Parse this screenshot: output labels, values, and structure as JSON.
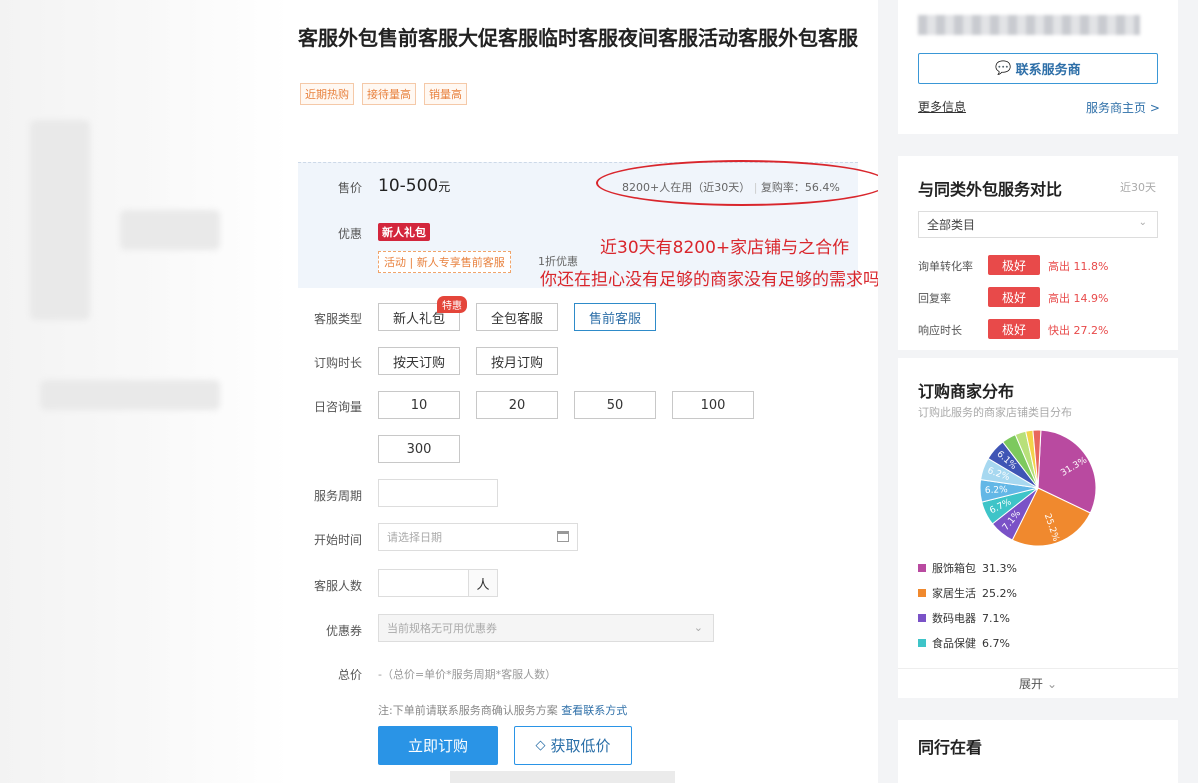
{
  "title": "客服外包售前客服大促客服临时客服夜间客服活动客服外包客服",
  "tags": [
    "近期热购",
    "接待量高",
    "销量高"
  ],
  "price": {
    "label": "售价",
    "value": "10-500",
    "unit": "元",
    "users": "8200+人在用（近30天）",
    "repurchase": "复购率：56.4%"
  },
  "promo": {
    "label": "优惠",
    "gift_badge": "新人礼包",
    "tag": "活动 | 新人专享售前客服",
    "discount": "1折优惠"
  },
  "annotation": {
    "line1": "近30天有8200+家店铺与之合作",
    "line2": "你还在担心没有足够的商家没有足够的需求吗？"
  },
  "form": {
    "service_type": {
      "label": "客服类型",
      "options": [
        "新人礼包",
        "全包客服",
        "售前客服"
      ],
      "hot_badge": "特惠",
      "selected": "售前客服"
    },
    "duration": {
      "label": "订购时长",
      "options": [
        "按天订购",
        "按月订购"
      ]
    },
    "volume": {
      "label": "日咨询量",
      "options": [
        "10",
        "20",
        "50",
        "100",
        "300"
      ]
    },
    "period": {
      "label": "服务周期",
      "value": ""
    },
    "start_date": {
      "label": "开始时间",
      "placeholder": "请选择日期"
    },
    "staff_count": {
      "label": "客服人数",
      "value": "",
      "unit": "人"
    },
    "coupon": {
      "label": "优惠券",
      "placeholder": "当前规格无可用优惠券"
    },
    "total": {
      "label": "总价",
      "formula": "-（总价=单价*服务周期*客服人数）"
    },
    "note": "注:下单前请联系服务商确认服务方案",
    "note_link": "查看联系方式",
    "order_button": "立即订购",
    "lowprice_button": "获取低价"
  },
  "sidebar": {
    "contact_button": "联系服务商",
    "more_info": "更多信息",
    "provider_home": "服务商主页 >",
    "compare": {
      "title": "与同类外包服务对比",
      "range": "近30天",
      "category": "全部类目",
      "rows": [
        {
          "label": "询单转化率",
          "badge": "极好",
          "value": "高出 11.8%"
        },
        {
          "label": "回复率",
          "badge": "极好",
          "value": "高出 14.9%"
        },
        {
          "label": "响应时长",
          "badge": "极好",
          "value": "快出 27.2%"
        }
      ]
    },
    "distribution": {
      "title": "订购商家分布",
      "subtitle": "订购此服务的商家店铺类目分布",
      "legend": [
        {
          "name": "服饰箱包",
          "value": "31.3%",
          "color": "#b94aa0"
        },
        {
          "name": "家居生活",
          "value": "25.2%",
          "color": "#f0892e"
        },
        {
          "name": "数码电器",
          "value": "7.1%",
          "color": "#7a52c7"
        },
        {
          "name": "食品保健",
          "value": "6.7%",
          "color": "#3ec4c8"
        }
      ],
      "expand": "展开"
    },
    "peers_title": "同行在看"
  },
  "chart_data": {
    "type": "pie",
    "slices": [
      {
        "name": "服饰箱包",
        "value": 31.3,
        "color": "#b94aa0",
        "label": "31.3%"
      },
      {
        "name": "家居生活",
        "value": 25.2,
        "color": "#f0892e",
        "label": "25.2%"
      },
      {
        "name": "数码电器",
        "value": 7.1,
        "color": "#7a52c7",
        "label": "7.1%"
      },
      {
        "name": "食品保健",
        "value": 6.7,
        "color": "#3ec4c8",
        "label": "6.7%"
      },
      {
        "name": "",
        "value": 6.2,
        "color": "#63b7e6",
        "label": "6.2%"
      },
      {
        "name": "",
        "value": 6.2,
        "color": "#a7d8f0",
        "label": "6.2%"
      },
      {
        "name": "",
        "value": 6.1,
        "color": "#3f55b5",
        "label": "6.1%"
      },
      {
        "name": "",
        "value": 4.0,
        "color": "#7dc95e",
        "label": ""
      },
      {
        "name": "",
        "value": 3.0,
        "color": "#b8e07a",
        "label": ""
      },
      {
        "name": "",
        "value": 2.0,
        "color": "#f3d44a",
        "label": ""
      },
      {
        "name": "",
        "value": 2.2,
        "color": "#e8685e",
        "label": ""
      }
    ]
  }
}
